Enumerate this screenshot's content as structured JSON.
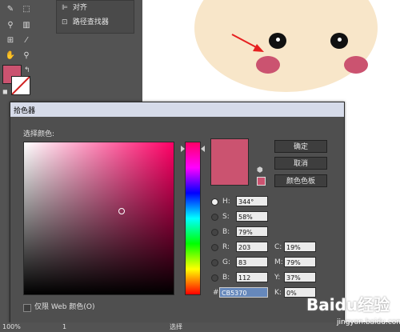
{
  "panel": {
    "items": [
      {
        "label": "对齐",
        "icon": "align-icon"
      },
      {
        "label": "路径查找器",
        "icon": "pathfinder-icon"
      }
    ]
  },
  "tools": {
    "icons": [
      "pen-icon",
      "selection-icon",
      "type-icon",
      "graph-icon",
      "artboard-icon",
      "eyedropper-icon",
      "hand-icon",
      "zoom-icon"
    ],
    "fill_color": "#cb5370"
  },
  "dialog": {
    "title": "拾色器",
    "select_color_label": "选择颜色:",
    "buttons": {
      "ok": "确定",
      "cancel": "取消",
      "swatches": "颜色色板"
    },
    "fields": {
      "H": {
        "label": "H:",
        "value": "344°"
      },
      "S": {
        "label": "S:",
        "value": "58%"
      },
      "B": {
        "label": "B:",
        "value": "79%"
      },
      "R": {
        "label": "R:",
        "value": "203"
      },
      "G": {
        "label": "G:",
        "value": "83"
      },
      "Bl": {
        "label": "B:",
        "value": "112"
      },
      "C": {
        "label": "C:",
        "value": "19%"
      },
      "M": {
        "label": "M:",
        "value": "79%"
      },
      "Y": {
        "label": "Y:",
        "value": "37%"
      },
      "K": {
        "label": "K:",
        "value": "0%"
      },
      "hex": {
        "label": "#",
        "value": "CB5370"
      }
    },
    "web_only_label": "仅限 Web 颜色(O)",
    "web_only_checked": false,
    "current_color": "#cb5370",
    "selected_radio": "H"
  },
  "statusbar": {
    "zoom": "100%",
    "page": "1",
    "mode": "选择"
  },
  "watermark": {
    "logo": "Baidu经验",
    "url": "jingyan.baidu.com"
  },
  "colors": {
    "face": "#f8e6c9",
    "cheek": "#cb5370",
    "arrow": "#e62020"
  }
}
